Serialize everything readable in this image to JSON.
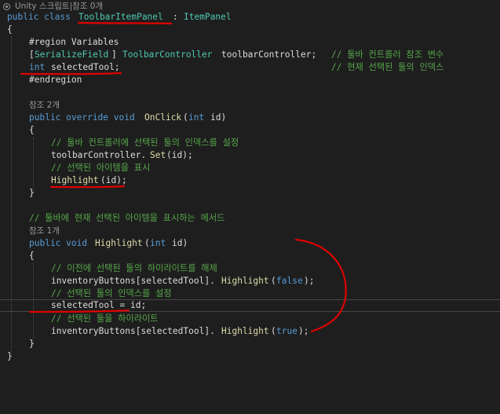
{
  "codelens": {
    "unity_label": "Unity 스크립트|참조 0개",
    "refs_onclick": "참조 2개",
    "refs_highlight": "참조 1개"
  },
  "code": {
    "class_kw": "public class",
    "class_name": "ToolbarItemPanel",
    "class_sep": ":",
    "base_class": "ItemPanel",
    "brace_open": "{",
    "brace_close": "}",
    "region": "#region Variables",
    "attr_open": "[",
    "attr_name": "SerializeField",
    "attr_close": "]",
    "field1_type": "ToolbarController",
    "field1_name": "toolbarController;",
    "field1_comment": "// 툴바 컨트롤러 참조 변수",
    "field2_type": "int",
    "field2_name": "selectedTool;",
    "field2_comment": "// 현재 선택된 툴의 인덱스",
    "endregion": "#endregion",
    "onclick_mods": "public override void",
    "onclick_name": "OnClick",
    "onclick_paren": "(",
    "onclick_ptype": "int",
    "onclick_pname": "id)",
    "c1": "// 툴바 컨트롤러에 선택된 툴의 인덱스를 설정",
    "s1_obj": "toolbarController.",
    "s1_fn": "Set",
    "s1_args": "(id);",
    "c2": "// 선택된 아이템을 표시",
    "s2_fn": "Highlight",
    "s2_args": "(id);",
    "c3": "// 툴바에 현재 선택된 아이템을 표시하는 메서드",
    "hl_mods": "public void",
    "hl_name": "Highlight",
    "hl_paren": "(",
    "hl_ptype": "int",
    "hl_pname": "id)",
    "c4": "// 이전에 선택된 툴의 하이라이트를 해제",
    "s3_obj": "inventoryButtons[selectedTool].",
    "s3_fn": "Highlight",
    "s3_open": "(",
    "s3_arg": "false",
    "s3_close": ");",
    "c5": "// 선택된 툴의 인덱스를 설정",
    "s4": "selectedTool = id;",
    "c6": "// 선택된 툴을 하이라이트",
    "s5_obj": "inventoryButtons[selectedTool].",
    "s5_fn": "Highlight",
    "s5_open": "(",
    "s5_arg": "true",
    "s5_close": ");"
  },
  "colors": {
    "background": "#1e1e1e",
    "keyword": "#569cd6",
    "type": "#4ec9b0",
    "function": "#dcdcaa",
    "comment": "#57a64a",
    "text": "#dcdcdc",
    "annotation_ink": "#e00000"
  },
  "icons": {
    "codelens": "unity-icon"
  }
}
